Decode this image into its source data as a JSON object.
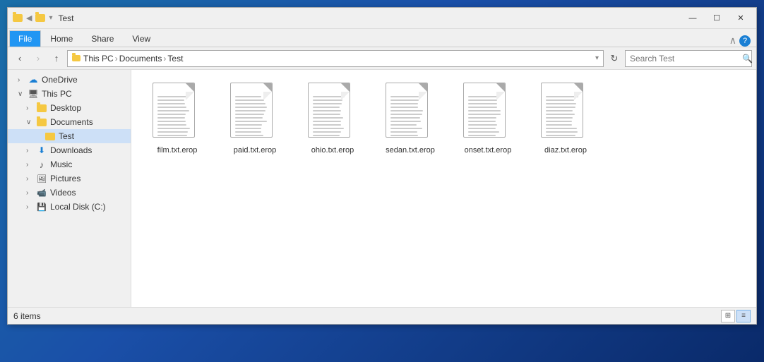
{
  "window": {
    "title": "Test",
    "titlebar_icons": [
      "folder-icon"
    ],
    "controls": {
      "minimize": "—",
      "maximize": "☐",
      "close": "✕"
    }
  },
  "ribbon": {
    "tabs": [
      {
        "id": "file",
        "label": "File",
        "active": true
      },
      {
        "id": "home",
        "label": "Home",
        "active": false
      },
      {
        "id": "share",
        "label": "Share",
        "active": false
      },
      {
        "id": "view",
        "label": "View",
        "active": false
      }
    ]
  },
  "address_bar": {
    "back_disabled": false,
    "forward_disabled": true,
    "up_disabled": false,
    "breadcrumb": [
      "This PC",
      "Documents",
      "Test"
    ],
    "search_placeholder": "Search Test"
  },
  "sidebar": {
    "items": [
      {
        "id": "onedrive",
        "label": "OneDrive",
        "icon": "cloud",
        "indent": 1,
        "expanded": false
      },
      {
        "id": "this-pc",
        "label": "This PC",
        "icon": "pc",
        "indent": 1,
        "expanded": true
      },
      {
        "id": "desktop",
        "label": "Desktop",
        "icon": "folder",
        "indent": 2,
        "expanded": false
      },
      {
        "id": "documents",
        "label": "Documents",
        "icon": "folder",
        "indent": 2,
        "expanded": true
      },
      {
        "id": "test",
        "label": "Test",
        "icon": "folder-open",
        "indent": 3,
        "selected": true
      },
      {
        "id": "downloads",
        "label": "Downloads",
        "icon": "download-folder",
        "indent": 2,
        "expanded": false
      },
      {
        "id": "music",
        "label": "Music",
        "icon": "music",
        "indent": 2,
        "expanded": false
      },
      {
        "id": "pictures",
        "label": "Pictures",
        "icon": "pictures",
        "indent": 2,
        "expanded": false
      },
      {
        "id": "videos",
        "label": "Videos",
        "icon": "videos",
        "indent": 2,
        "expanded": false
      },
      {
        "id": "local-disk",
        "label": "Local Disk (C:)",
        "icon": "drive",
        "indent": 2,
        "expanded": false
      }
    ]
  },
  "files": [
    {
      "name": "film.txt.erop",
      "icon": "document"
    },
    {
      "name": "paid.txt.erop",
      "icon": "document"
    },
    {
      "name": "ohio.txt.erop",
      "icon": "document"
    },
    {
      "name": "sedan.txt.erop",
      "icon": "document"
    },
    {
      "name": "onset.txt.erop",
      "icon": "document"
    },
    {
      "name": "diaz.txt.erop",
      "icon": "document"
    }
  ],
  "status_bar": {
    "item_count": "6 items",
    "views": [
      "grid",
      "list"
    ]
  }
}
